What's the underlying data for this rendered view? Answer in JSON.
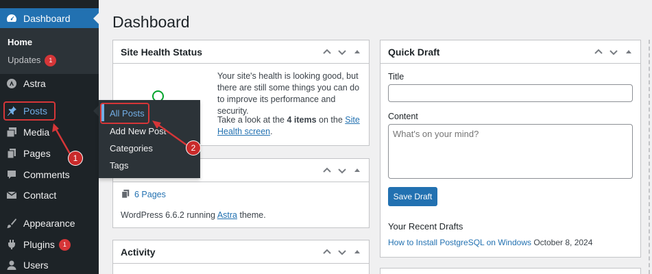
{
  "sidebar": {
    "dashboard_label": "Dashboard",
    "home_label": "Home",
    "updates_label": "Updates",
    "updates_count": "1",
    "astra_label": "Astra",
    "posts_label": "Posts",
    "media_label": "Media",
    "pages_label": "Pages",
    "comments_label": "Comments",
    "contact_label": "Contact",
    "appearance_label": "Appearance",
    "plugins_label": "Plugins",
    "plugins_count": "1",
    "users_label": "Users"
  },
  "flyout": {
    "items": [
      "All Posts",
      "Add New Post",
      "Categories",
      "Tags"
    ]
  },
  "page_title": "Dashboard",
  "site_health": {
    "title": "Site Health Status",
    "text1": "Your site's health is looking good, but there are still some things you can do to improve its performance and security.",
    "text2_prefix": "Take a look at the ",
    "text2_bold": "4 items",
    "text2_mid": " on the ",
    "text2_link": "Site Health screen",
    "text2_suffix": "."
  },
  "glance": {
    "pages_link": "6 Pages",
    "wp_prefix": "WordPress 6.6.2 running ",
    "theme_link": "Astra",
    "wp_suffix": " theme."
  },
  "activity": {
    "title": "Activity"
  },
  "quick_draft": {
    "title": "Quick Draft",
    "title_label": "Title",
    "title_value": "",
    "content_label": "Content",
    "content_placeholder": "What's on your mind?",
    "save_label": "Save Draft",
    "recent_title": "Your Recent Drafts",
    "recent_link": "How to Install PostgreSQL on Windows",
    "recent_date": "October 8, 2024"
  },
  "annotations": {
    "step1": "1",
    "step2": "2"
  },
  "colors": {
    "sidebar_bg": "#1d2327",
    "accent": "#2271b1",
    "annotation": "#d63638"
  }
}
